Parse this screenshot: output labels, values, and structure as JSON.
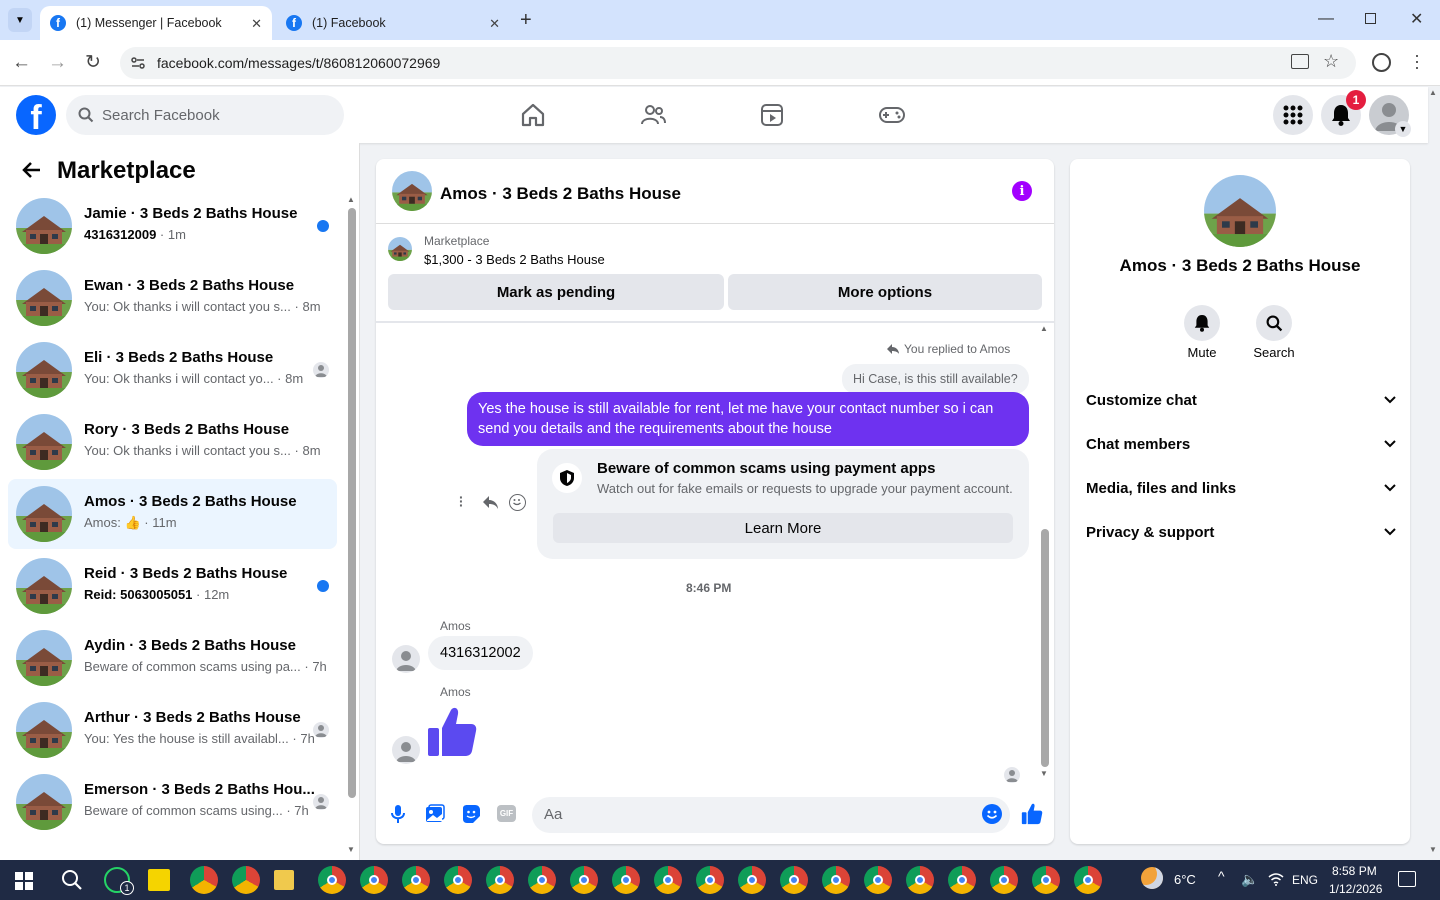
{
  "browser": {
    "tabs": [
      {
        "title": "(1) Messenger | Facebook",
        "active": true
      },
      {
        "title": "(1) Facebook",
        "active": false
      }
    ],
    "url": "facebook.com/messages/t/860812060072969"
  },
  "fb_header": {
    "search_placeholder": "Search Facebook",
    "notification_count": "1",
    "logo_letter": "f"
  },
  "left": {
    "title": "Marketplace",
    "conversations": [
      {
        "name": "Jamie · 3 Beds 2 Baths House",
        "preview": "4316312009",
        "time": " · 1m",
        "unread": true,
        "indicator": "dot"
      },
      {
        "name": "Ewan · 3 Beds 2 Baths House",
        "preview": "You: Ok thanks i will contact you s...",
        "time": " · 8m",
        "unread": false,
        "indicator": "none"
      },
      {
        "name": "Eli · 3 Beds 2 Baths House",
        "preview": "You: Ok thanks i will contact yo...",
        "time": " · 8m",
        "unread": false,
        "indicator": "seen"
      },
      {
        "name": "Rory · 3 Beds 2 Baths House",
        "preview": "You: Ok thanks i will contact you s...",
        "time": " · 8m",
        "unread": false,
        "indicator": "none"
      },
      {
        "name": "Amos · 3 Beds 2 Baths House",
        "preview": "Amos: 👍",
        "time": " · 11m",
        "unread": false,
        "indicator": "none",
        "selected": true
      },
      {
        "name": "Reid · 3 Beds 2 Baths House",
        "preview": "Reid: 5063005051",
        "time": " · 12m",
        "unread": true,
        "indicator": "dot"
      },
      {
        "name": "Aydin · 3 Beds 2 Baths House",
        "preview": "Beware of common scams using pa...",
        "time": " · 7h",
        "unread": false,
        "indicator": "none"
      },
      {
        "name": "Arthur · 3 Beds 2 Baths House",
        "preview": "You: Yes the house is still availabl...",
        "time": " · 7h",
        "unread": false,
        "indicator": "seen"
      },
      {
        "name": "Emerson · 3 Beds 2 Baths Hou...",
        "preview": "Beware of common scams using...",
        "time": " · 7h",
        "unread": false,
        "indicator": "seen"
      }
    ]
  },
  "chat": {
    "title": "Amos · 3 Beds 2 Baths House",
    "listing": {
      "source": "Marketplace",
      "summary": "$1,300 - 3 Beds 2 Baths House"
    },
    "mark_pending": "Mark as pending",
    "more_options": "More options",
    "replied_to": "You replied to Amos",
    "quoted": "Hi Case, is this still available?",
    "outgoing": "Yes the house is still available for rent, let me have your contact number so i can send you details and the requirements about the house",
    "scam": {
      "title": "Beware of common scams using payment apps",
      "body": "Watch out for fake emails or requests to upgrade your payment account.",
      "button": "Learn More"
    },
    "timestamp": "8:46 PM",
    "sender": "Amos",
    "incoming_number": "4316312002",
    "composer_placeholder": "Aa"
  },
  "right": {
    "name": "Amos · 3 Beds 2 Baths House",
    "mute": "Mute",
    "search": "Search",
    "sections": [
      "Customize chat",
      "Chat members",
      "Media, files and links",
      "Privacy & support"
    ]
  },
  "taskbar": {
    "temperature": "6°C",
    "language": "ENG",
    "time": "8:58 PM",
    "date": "1/12/2026"
  },
  "colors": {
    "accent": "#0866ff",
    "bubble": "#6e32f0",
    "unread_dot": "#1877f2"
  }
}
